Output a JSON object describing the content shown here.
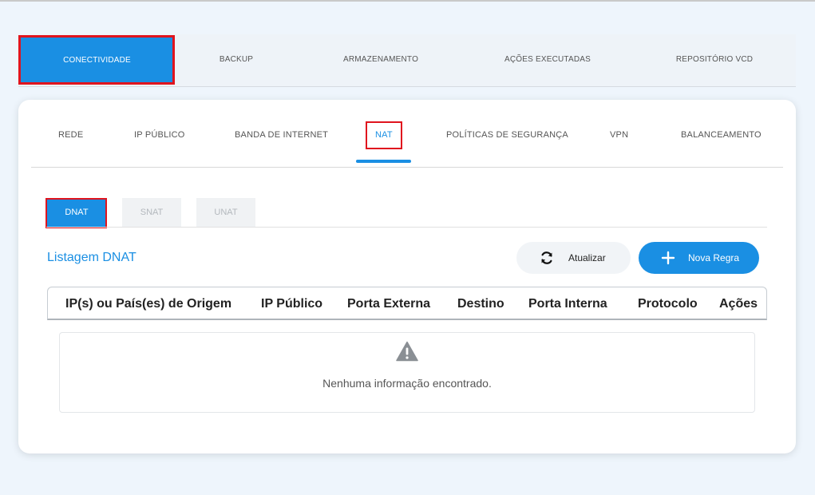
{
  "top_tabs": [
    "CONECTIVIDADE",
    "BACKUP",
    "ARMAZENAMENTO",
    "AÇÕES EXECUTADAS",
    "REPOSITÓRIO VCD"
  ],
  "sub_tabs": [
    "REDE",
    "IP PÚBLICO",
    "BANDA DE INTERNET",
    "NAT",
    "POLÍTICAS DE SEGURANÇA",
    "VPN",
    "BALANCEAMENTO"
  ],
  "inner_tabs": [
    "DNAT",
    "SNAT",
    "UNAT"
  ],
  "list_title": "Listagem DNAT",
  "buttons": {
    "refresh": "Atualizar",
    "new_rule": "Nova Regra"
  },
  "table": {
    "headers": [
      "IP(s) ou País(es) de Origem",
      "IP Público",
      "Porta Externa",
      "Destino",
      "Porta Interna",
      "Protocolo",
      "Ações"
    ],
    "empty_message": "Nenhuma informação encontrado."
  },
  "colors": {
    "accent": "#1a8fe3",
    "highlight": "#e0141e",
    "background": "#eef5fc"
  }
}
